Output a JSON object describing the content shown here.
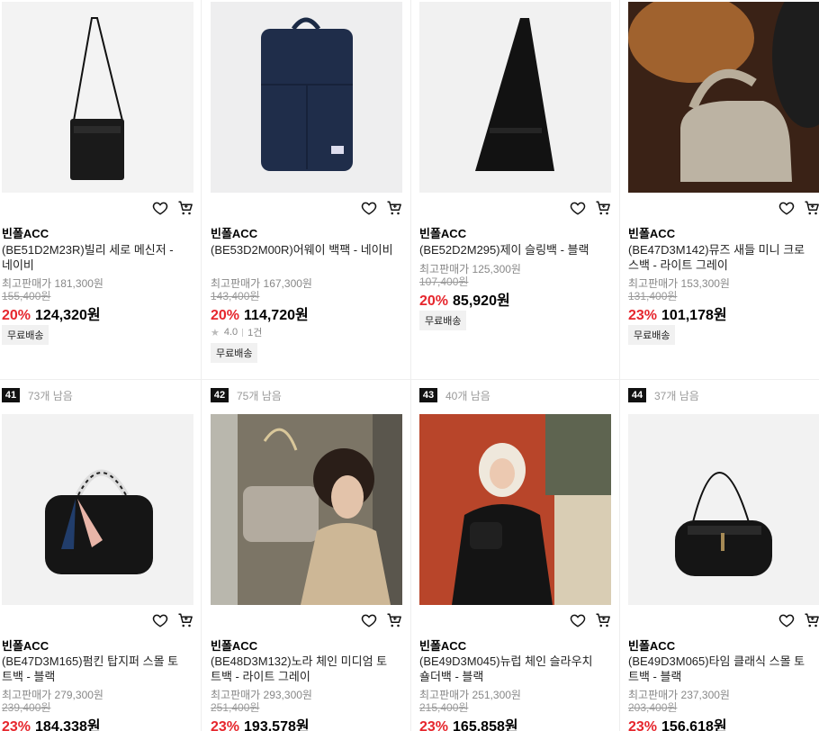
{
  "products": [
    {
      "brand": "빈폴ACC",
      "name": "(BE51D2M23R)빌리 세로 메신저 - 네이비",
      "ref_price": "최고판매가 181,300원",
      "orig_price": "155,400원",
      "discount": "20%",
      "price": "124,320원",
      "badge": "무료배송",
      "icon": "messenger-bag-image"
    },
    {
      "brand": "빈폴ACC",
      "name": "(BE53D2M00R)어웨이 백팩 - 네이비",
      "ref_price": "최고판매가 167,300원",
      "orig_price": "143,400원",
      "discount": "20%",
      "price": "114,720원",
      "rating": "4.0",
      "review_count": "1건",
      "badge": "무료배송",
      "icon": "backpack-image"
    },
    {
      "brand": "빈폴ACC",
      "name": "(BE52D2M295)제이 슬링백 - 블랙",
      "ref_price": "최고판매가 125,300원",
      "orig_price": "107,400원",
      "discount": "20%",
      "price": "85,920원",
      "badge": "무료배송",
      "icon": "sling-bag-image"
    },
    {
      "brand": "빈폴ACC",
      "name": "(BE47D3M142)뮤즈 새들 미니 크로스백 - 라이트 그레이",
      "ref_price": "최고판매가 153,300원",
      "orig_price": "131,400원",
      "discount": "23%",
      "price": "101,178원",
      "badge": "무료배송",
      "icon": "saddle-bag-image"
    },
    {
      "rank": "41",
      "remaining": "73개 남음",
      "brand": "빈폴ACC",
      "name": "(BE47D3M165)펌킨 탑지퍼 스몰 토트백 - 블랙",
      "ref_price": "최고판매가 279,300원",
      "orig_price": "239,400원",
      "discount": "23%",
      "price": "184,338원",
      "icon": "tote-bag-image"
    },
    {
      "rank": "42",
      "remaining": "75개 남음",
      "brand": "빈폴ACC",
      "name": "(BE48D3M132)노라 체인 미디엄 토트백 - 라이트 그레이",
      "ref_price": "최고판매가 293,300원",
      "orig_price": "251,400원",
      "discount": "23%",
      "price": "193,578원",
      "icon": "model-photo-image"
    },
    {
      "rank": "43",
      "remaining": "40개 남음",
      "brand": "빈폴ACC",
      "name": "(BE49D3M045)뉴럽 체인 슬라우치 숄더백 - 블랙",
      "ref_price": "최고판매가 251,300원",
      "orig_price": "215,400원",
      "discount": "23%",
      "price": "165,858원",
      "icon": "model-photo-image"
    },
    {
      "rank": "44",
      "remaining": "37개 남음",
      "brand": "빈폴ACC",
      "name": "(BE49D3M065)타임 클래식 스몰 토트백 - 블랙",
      "ref_price": "최고판매가 237,300원",
      "orig_price": "203,400원",
      "discount": "23%",
      "price": "156,618원",
      "icon": "shoulder-bag-image"
    }
  ],
  "colors": {
    "discount": "#e6262d",
    "rank_bg": "#111111",
    "placeholder": "#f2f2f2"
  }
}
